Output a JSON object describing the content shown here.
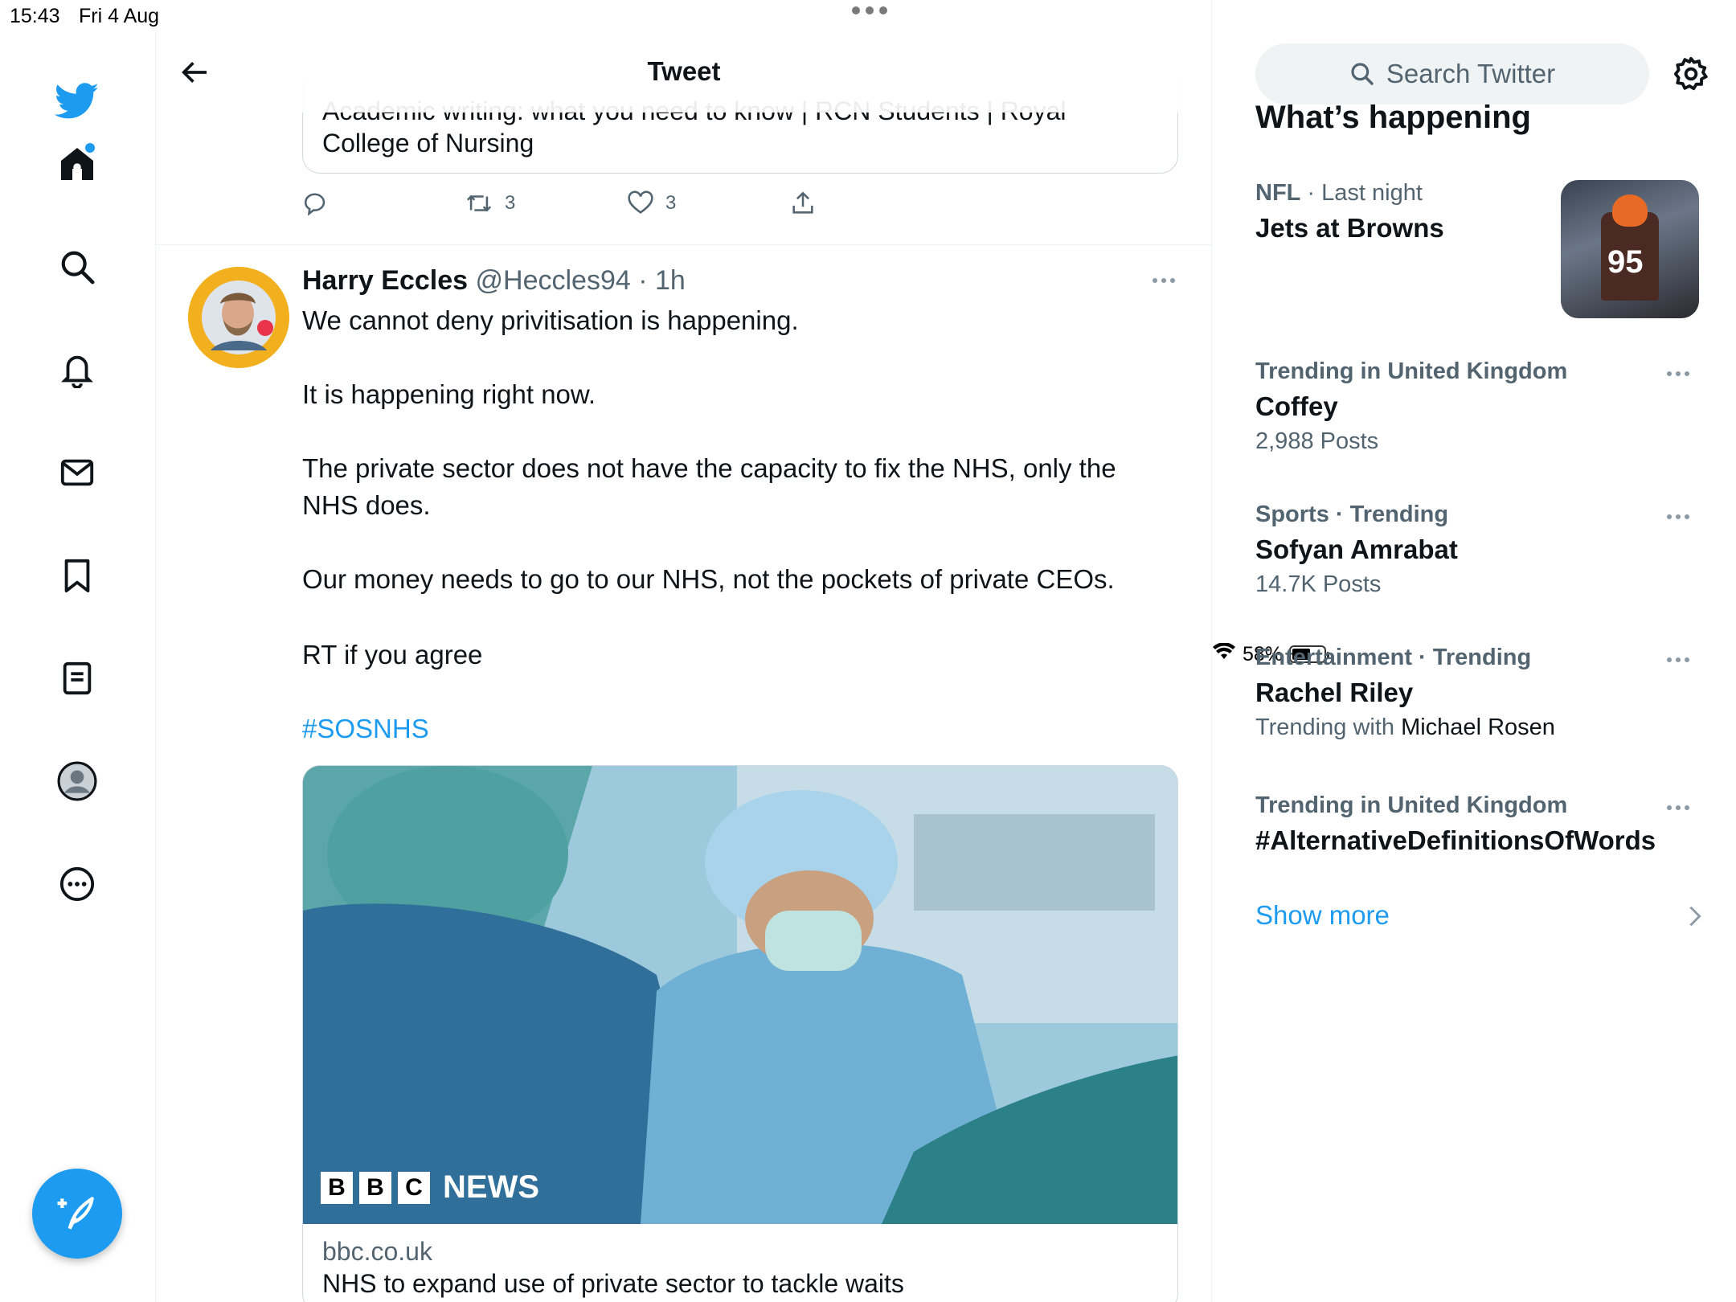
{
  "status_bar": {
    "time": "15:43",
    "date": "Fri 4 Aug",
    "battery": "58%",
    "battery_level": 0.58
  },
  "header": {
    "title": "Tweet"
  },
  "previous_card": {
    "title_line1": "Academic writing: what you need to know | RCN Students | Royal",
    "title_line2": "College of Nursing"
  },
  "previous_actions": {
    "retweets": "3",
    "likes": "3"
  },
  "tweet": {
    "author_name": "Harry Eccles",
    "author_handle": "@Heccles94",
    "time": "· 1h",
    "lines": [
      "We cannot deny privitisation is happening.",
      "It is happening right now.",
      "The private sector does not have the capacity to fix the NHS, only the",
      "NHS does.",
      "Our money needs to go to our NHS, not the pockets of private CEOs.",
      "RT if you agree"
    ],
    "hashtag": "#SOSNHS",
    "link_card": {
      "logo_letters": [
        "B",
        "B",
        "C"
      ],
      "logo_word": "NEWS",
      "domain": "bbc.co.uk",
      "headline": "NHS to expand use of private sector to tackle waits"
    }
  },
  "sidebar": {
    "search_placeholder": "Search Twitter",
    "section_title": "What’s happening",
    "trends": [
      {
        "context_main": "NFL",
        "context_rest": " · Last night",
        "title": "Jets at Browns",
        "sub": ""
      },
      {
        "context_main": "Trending in United Kingdom",
        "context_rest": "",
        "title": "Coffey",
        "sub": "2,988 Posts"
      },
      {
        "context_main": "Sports · Trending",
        "context_rest": "",
        "title": "Sofyan Amrabat",
        "sub": "14.7K Posts"
      },
      {
        "context_main": "Entertainment · Trending",
        "context_rest": "",
        "title": "Rachel Riley",
        "sub": "Trending with ",
        "sub_dark": "Michael Rosen"
      },
      {
        "context_main": "Trending in United Kingdom",
        "context_rest": "",
        "title": "#AlternativeDefinitionsOfWords",
        "sub": ""
      }
    ],
    "show_more": "Show more"
  },
  "colors": {
    "accent": "#1d9bf0",
    "muted": "#536471",
    "text": "#0f1419"
  }
}
